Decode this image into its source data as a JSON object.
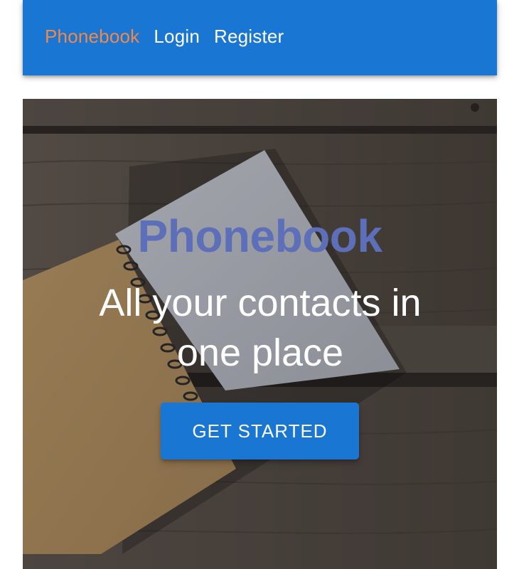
{
  "header": {
    "nav": [
      {
        "label": "Phonebook"
      },
      {
        "label": "Login"
      },
      {
        "label": "Register"
      }
    ]
  },
  "hero": {
    "title": "Phonebook",
    "subtitle": "All your contacts in one place",
    "cta_label": "GET STARTED"
  },
  "colors": {
    "primary": "#1976d2",
    "brand_link": "#f0894b",
    "hero_title": "#5c6fb8"
  }
}
